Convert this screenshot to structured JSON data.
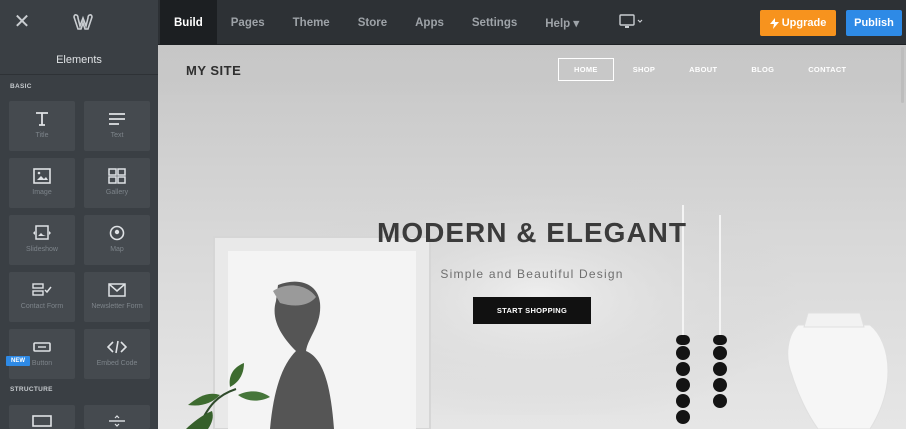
{
  "app": {
    "close_icon": "close-icon",
    "logo_icon": "weebly-logo-icon"
  },
  "nav": {
    "items": [
      {
        "label": "Build",
        "active": true
      },
      {
        "label": "Pages"
      },
      {
        "label": "Theme"
      },
      {
        "label": "Store"
      },
      {
        "label": "Apps"
      },
      {
        "label": "Settings"
      },
      {
        "label": "Help ▾"
      }
    ],
    "device_icon": "desktop-device-icon"
  },
  "actions": {
    "upgrade_label": "Upgrade",
    "publish_label": "Publish",
    "upgrade_color": "#f7931e",
    "publish_color": "#2e8ae6"
  },
  "sidebar": {
    "title": "Elements",
    "sections": {
      "basic": "BASIC",
      "structure": "STRUCTURE"
    },
    "tiles": [
      {
        "label": "Title",
        "icon": "title-icon"
      },
      {
        "label": "Text",
        "icon": "text-icon"
      },
      {
        "label": "Image",
        "icon": "image-icon"
      },
      {
        "label": "Gallery",
        "icon": "gallery-icon"
      },
      {
        "label": "Slideshow",
        "icon": "slideshow-icon"
      },
      {
        "label": "Map",
        "icon": "map-icon"
      },
      {
        "label": "Contact Form",
        "icon": "contact-form-icon"
      },
      {
        "label": "Newsletter Form",
        "icon": "newsletter-icon"
      },
      {
        "label": "Button",
        "icon": "button-icon"
      },
      {
        "label": "Embed Code",
        "icon": "embed-code-icon"
      }
    ],
    "new_badge": "NEW"
  },
  "site": {
    "brand": "MY SITE",
    "nav": [
      "HOME",
      "SHOP",
      "ABOUT",
      "BLOG",
      "CONTACT"
    ],
    "hero_title": "MODERN & ELEGANT",
    "hero_subtitle": "Simple and Beautiful Design",
    "hero_button": "START SHOPPING"
  }
}
